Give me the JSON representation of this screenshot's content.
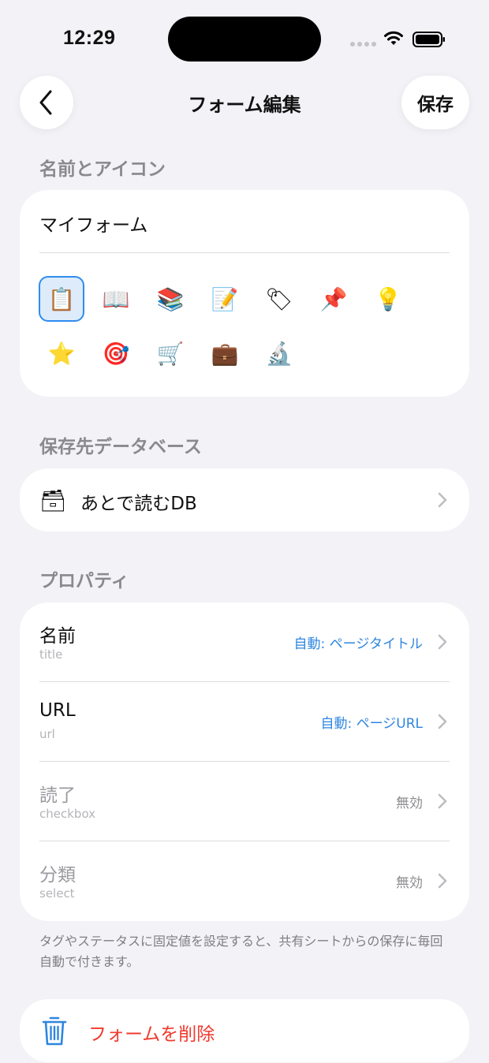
{
  "status_bar": {
    "time": "12:29"
  },
  "nav": {
    "title": "フォーム編集",
    "save_label": "保存"
  },
  "name_icon": {
    "section_label": "名前とアイコン",
    "form_name": "マイフォーム",
    "icons": [
      {
        "name": "clipboard-icon",
        "glyph": "📋",
        "selected": true
      },
      {
        "name": "open-book-icon",
        "glyph": "📖",
        "selected": false
      },
      {
        "name": "books-icon",
        "glyph": "📚",
        "selected": false
      },
      {
        "name": "memo-icon",
        "glyph": "📝",
        "selected": false
      },
      {
        "name": "tag-label-icon",
        "glyph": "🏷",
        "selected": false
      },
      {
        "name": "pushpin-icon",
        "glyph": "📌",
        "selected": false
      },
      {
        "name": "light-bulb-icon",
        "glyph": "💡",
        "selected": false
      },
      {
        "name": "star-icon",
        "glyph": "⭐",
        "selected": false
      },
      {
        "name": "target-icon",
        "glyph": "🎯",
        "selected": false
      },
      {
        "name": "shopping-cart-icon",
        "glyph": "🛒",
        "selected": false
      },
      {
        "name": "briefcase-icon",
        "glyph": "💼",
        "selected": false
      },
      {
        "name": "microscope-icon",
        "glyph": "🔬",
        "selected": false
      }
    ]
  },
  "database": {
    "section_label": "保存先データベース",
    "db_icon": "file-cabinet-icon",
    "db_glyph": "🗃",
    "db_name": "あとで読むDB"
  },
  "properties": {
    "section_label": "プロパティ",
    "rows": [
      {
        "name": "名前",
        "type": "title",
        "value": "自動: ページタイトル",
        "state": "auto"
      },
      {
        "name": "URL",
        "type": "url",
        "value": "自動: ページURL",
        "state": "auto"
      },
      {
        "name": "読了",
        "type": "checkbox",
        "value": "無効",
        "state": "off"
      },
      {
        "name": "分類",
        "type": "select",
        "value": "無効",
        "state": "off"
      }
    ],
    "footnote": "タグやステータスに固定値を設定すると、共有シートからの保存に毎回自動で付きます。"
  },
  "delete": {
    "label": "フォームを削除"
  },
  "colors": {
    "accent": "#2F86E0",
    "destructive": "#F03A2E",
    "background": "#F2F2F7"
  }
}
